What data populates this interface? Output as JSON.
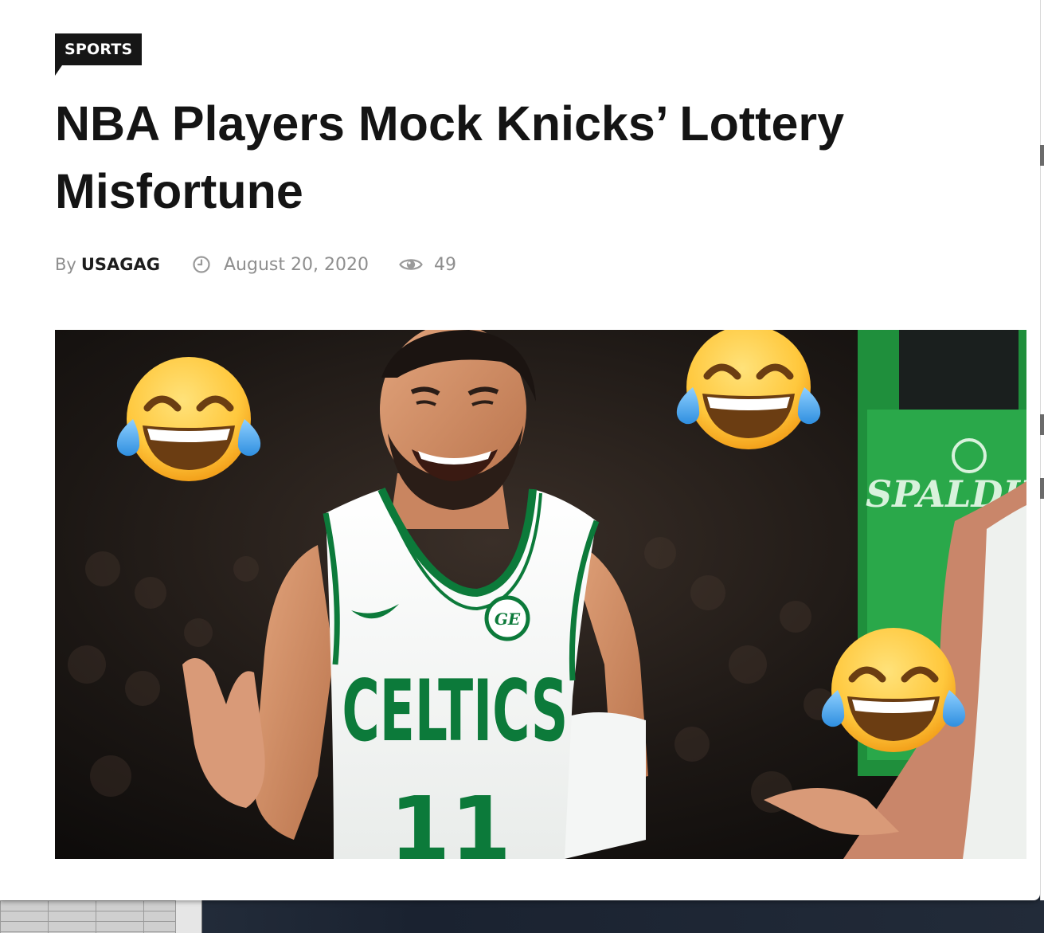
{
  "article": {
    "category": "SPORTS",
    "title": "NBA Players Mock Knicks’ Lottery Misfortune",
    "by_label": "By",
    "author": "USAGAG",
    "date": "August 20, 2020",
    "views": "49"
  },
  "featured_image": {
    "jersey_text": "CELTICS",
    "jersey_number": "11",
    "sponsor_patch": "GE",
    "sign_text": "SPALDING",
    "emoji": "face-with-tears-of-joy"
  },
  "colors": {
    "tag_background": "#161616",
    "headline": "#141414",
    "meta_text": "#8e8e8e",
    "author": "#1d1d1d",
    "celtics_green": "#0c7a3a",
    "emoji_yellow": "#ffc83d"
  },
  "icons": {
    "date_icon": "clock-icon",
    "views_icon": "eye-icon"
  }
}
